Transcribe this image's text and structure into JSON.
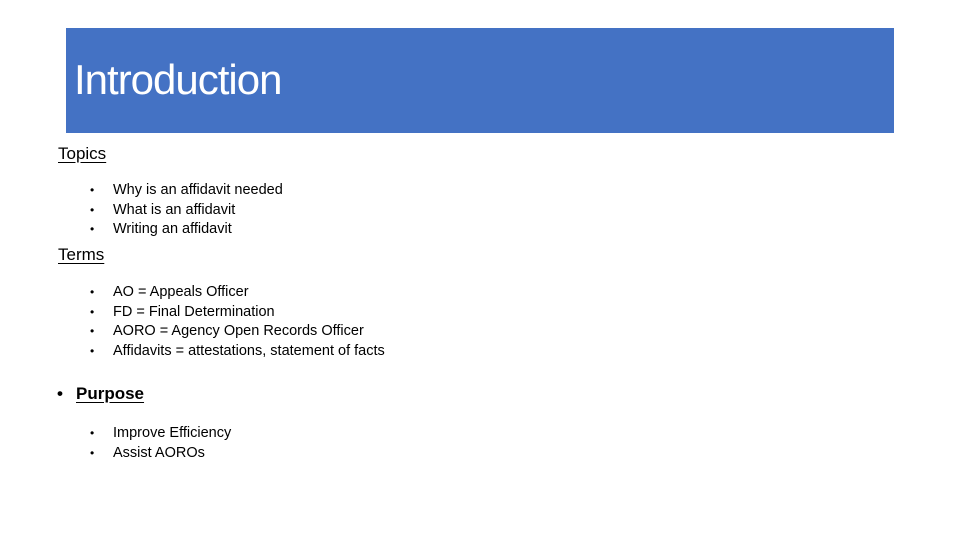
{
  "slide": {
    "title": "Introduction",
    "accent_color": "#4472C4"
  },
  "topics": {
    "heading": "Topics",
    "items": [
      "Why is an affidavit needed",
      "What is an affidavit",
      "Writing an affidavit"
    ]
  },
  "terms": {
    "heading": "Terms",
    "items": [
      "AO = Appeals Officer",
      "FD = Final Determination",
      "AORO = Agency Open Records Officer",
      "Affidavits = attestations, statement of facts"
    ]
  },
  "purpose": {
    "bullet": "•",
    "heading": "Purpose",
    "items": [
      "Improve Efficiency",
      "Assist AOROs"
    ]
  },
  "bullet_glyph": "•"
}
